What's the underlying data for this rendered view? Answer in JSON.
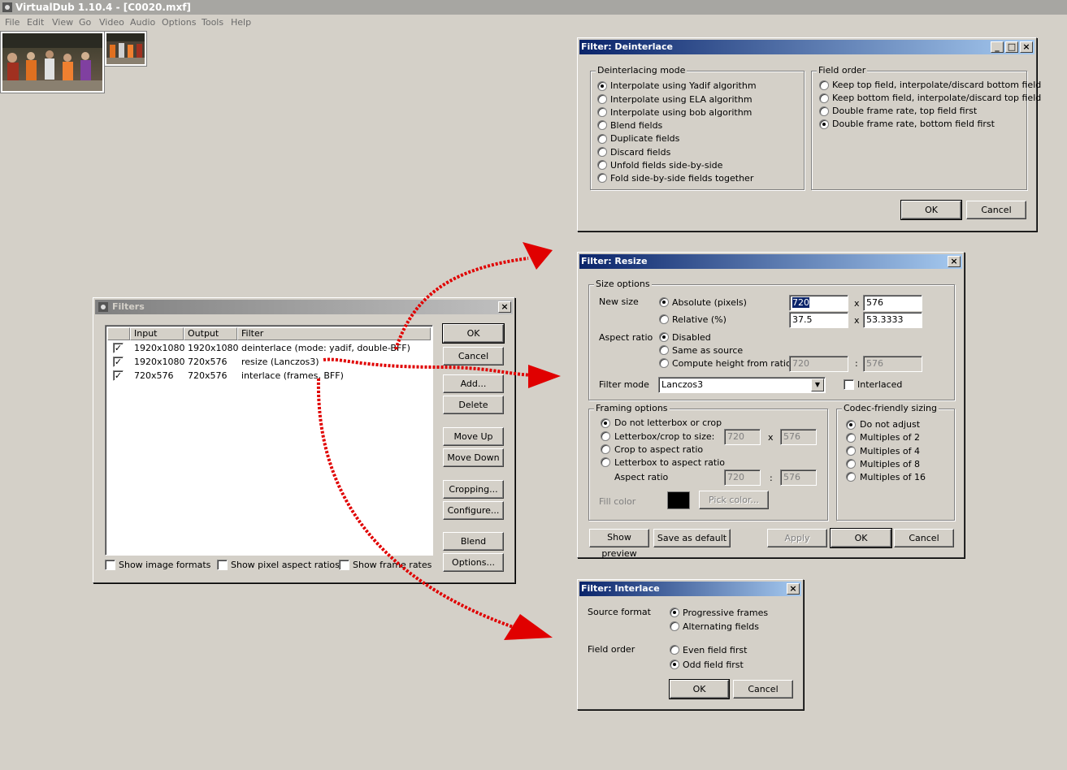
{
  "app": {
    "title": "VirtualDub 1.10.4 - [C0020.mxf]",
    "menu": [
      "File",
      "Edit",
      "View",
      "Go",
      "Video",
      "Audio",
      "Options",
      "Tools",
      "Help"
    ]
  },
  "filters_dialog": {
    "title": "Filters",
    "columns": [
      "Input",
      "Output",
      "Filter"
    ],
    "rows": [
      {
        "checked": true,
        "input": "1920x1080",
        "output": "1920x1080",
        "filter": "deinterlace (mode: yadif, double-BFF)"
      },
      {
        "checked": true,
        "input": "1920x1080",
        "output": "720x576",
        "filter": "resize (Lanczos3)"
      },
      {
        "checked": true,
        "input": "720x576",
        "output": "720x576",
        "filter": "interlace (frames, BFF)"
      }
    ],
    "buttons": {
      "ok": "OK",
      "cancel": "Cancel",
      "add": "Add...",
      "delete": "Delete",
      "move_up": "Move Up",
      "move_down": "Move Down",
      "cropping": "Cropping...",
      "configure": "Configure...",
      "blend": "Blend",
      "options": "Options..."
    },
    "checks": {
      "show_image_formats": "Show image formats",
      "show_pixel_aspect": "Show pixel aspect ratios",
      "show_frame_rates": "Show frame rates"
    }
  },
  "deinterlace_dialog": {
    "title": "Filter: Deinterlace",
    "mode_group": "Deinterlacing mode",
    "modes": [
      "Interpolate using Yadif algorithm",
      "Interpolate using ELA algorithm",
      "Interpolate using bob algorithm",
      "Blend fields",
      "Duplicate fields",
      "Discard fields",
      "Unfold fields side-by-side",
      "Fold side-by-side fields together"
    ],
    "selected_mode": 0,
    "field_group": "Field order",
    "field_orders": [
      "Keep top field, interpolate/discard bottom field",
      "Keep bottom field, interpolate/discard top field",
      "Double frame rate, top field first",
      "Double frame rate, bottom field first"
    ],
    "selected_field": 3,
    "ok": "OK",
    "cancel": "Cancel"
  },
  "resize_dialog": {
    "title": "Filter: Resize",
    "size_group": "Size options",
    "new_size_label": "New size",
    "absolute_label": "Absolute (pixels)",
    "relative_label": "Relative (%)",
    "abs_w": "720",
    "abs_h": "576",
    "rel_w": "37.5",
    "rel_h": "53.3333",
    "x": "x",
    "aspect_label": "Aspect ratio",
    "aspect_options": [
      "Disabled",
      "Same as source",
      "Compute height from ratio:"
    ],
    "ratio_w": "720",
    "ratio_h": "576",
    "colon": ":",
    "filter_mode_label": "Filter mode",
    "filter_mode": "Lanczos3",
    "interlaced_label": "Interlaced",
    "framing_group": "Framing options",
    "framing_options": [
      "Do not letterbox or crop",
      "Letterbox/crop to size:",
      "Crop to aspect ratio",
      "Letterbox to aspect ratio"
    ],
    "lb_w": "720",
    "lb_h": "576",
    "frame_aspect_label": "Aspect ratio",
    "fa_w": "720",
    "fa_h": "576",
    "fill_color_label": "Fill color",
    "pick_color": "Pick color...",
    "codec_group": "Codec-friendly sizing",
    "codec_options": [
      "Do not adjust",
      "Multiples of 2",
      "Multiples of 4",
      "Multiples of 8",
      "Multiples of 16"
    ],
    "show_preview": "Show preview",
    "save_default": "Save as default",
    "apply": "Apply",
    "ok": "OK",
    "cancel": "Cancel"
  },
  "interlace_dialog": {
    "title": "Filter: Interlace",
    "source_format_label": "Source format",
    "source_options": [
      "Progressive frames",
      "Alternating fields"
    ],
    "field_order_label": "Field order",
    "field_options": [
      "Even field first",
      "Odd field first"
    ],
    "ok": "OK",
    "cancel": "Cancel"
  },
  "colors": {
    "accent": "#0a246a",
    "arrow": "#e00000",
    "face": "#d4d0c8"
  }
}
